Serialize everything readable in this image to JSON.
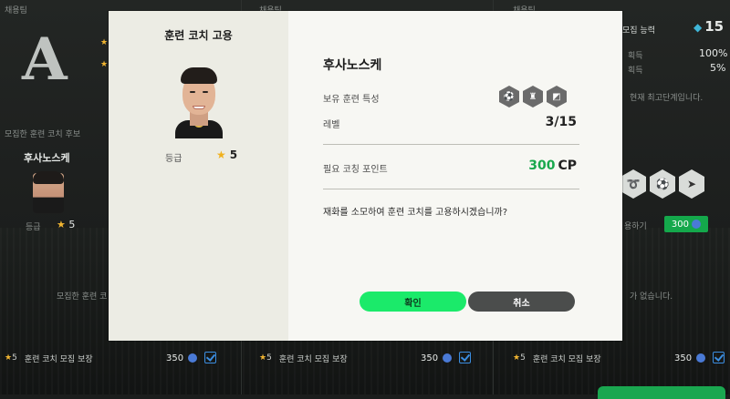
{
  "background": {
    "col1_header": "채용팀",
    "col2_header": "채용팀",
    "col3_header": "채용팀",
    "grade_letter": "A",
    "candidate_section_label": "모집한 훈련 코치 후보",
    "candidate_name": "후사노스케",
    "candidate_grade_label": "등급",
    "candidate_grade_value": "5",
    "recruit_coach_note": "모집한 훈련 코",
    "right_ability_label": "모집 능력",
    "right_gem_count": "15",
    "right_acq1_label": "획득",
    "right_acq1_value": "100%",
    "right_acq2_label": "획득",
    "right_acq2_value": "5%",
    "right_max_level_note": "현재 최고단계입니다.",
    "right_hire_label": "용하기",
    "right_hire_cost": "300",
    "right_empty_note": "가 없습니다.",
    "footer": [
      {
        "star": "5",
        "label": "훈련 코치 모집 보장",
        "cost": "350"
      },
      {
        "star": "5",
        "label": "훈련 코치 모집 보장",
        "cost": "350"
      },
      {
        "star": "5",
        "label": "훈련 코치 모집 보장",
        "cost": "350"
      }
    ]
  },
  "modal": {
    "title": "훈련 코치 고용",
    "grade_label": "등급",
    "grade_value": "5",
    "player_name": "후사노스케",
    "traits_label": "보유 훈련 특성",
    "traits": [
      "dribble-trait-icon",
      "trophy-trait-icon",
      "shield-trait-icon"
    ],
    "level_label": "레벨",
    "level_value": "3/15",
    "cp_label": "필요 코칭 포인트",
    "cp_value": "300",
    "cp_unit": "CP",
    "question": "재화를 소모하여 훈련 코치를 고용하시겠습니까?",
    "confirm_label": "확인",
    "cancel_label": "취소"
  },
  "colors": {
    "accent_green": "#1bea6a",
    "cp_green": "#19a84d",
    "star_gold": "#f0b11e"
  }
}
